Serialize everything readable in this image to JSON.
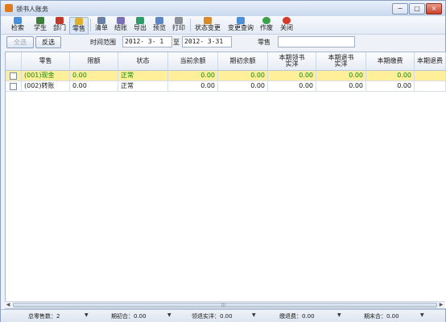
{
  "window": {
    "title": "领书人账务",
    "minimize": "−",
    "maximize": "□",
    "close": "×"
  },
  "toolbar": {
    "items": [
      {
        "label": "检索",
        "icon": "search-icon"
      },
      {
        "label": "学生",
        "icon": "student-icon"
      },
      {
        "label": "部门",
        "icon": "department-icon"
      },
      {
        "label": "零售",
        "icon": "retail-icon"
      },
      {
        "label": "清单",
        "icon": "list-icon"
      },
      {
        "label": "结账",
        "icon": "checkout-icon"
      },
      {
        "label": "导出",
        "icon": "export-icon"
      },
      {
        "label": "预览",
        "icon": "preview-icon"
      },
      {
        "label": "打印",
        "icon": "print-icon"
      },
      {
        "label": "状态变更",
        "icon": "status-change-icon"
      },
      {
        "label": "变更查询",
        "icon": "change-query-icon"
      },
      {
        "label": "作废",
        "icon": "void-icon"
      },
      {
        "label": "关闭",
        "icon": "close-icon"
      }
    ]
  },
  "filter": {
    "select_all": "全选",
    "invert": "反选",
    "time_range_label": "时间范围",
    "date_from": "2012- 3- 1",
    "to_label": "至",
    "date_to": "2012- 3-31",
    "retail_label": "零售",
    "retail_value": ""
  },
  "table": {
    "columns": [
      "零售",
      "限额",
      "状态",
      "当前余额",
      "期初余额",
      "本期领书\n实洋",
      "本期退书\n实洋",
      "本期缴费",
      "本期退费"
    ],
    "rows": [
      [
        "(001)现金",
        "0.00",
        "正常",
        "0.00",
        "0.00",
        "0.00",
        "0.00",
        "0.00",
        ""
      ],
      [
        "(002)转账",
        "0.00",
        "正常",
        "0.00",
        "0.00",
        "0.00",
        "0.00",
        "0.00",
        ""
      ]
    ]
  },
  "status": {
    "total_retail": "总零售数：2",
    "opening": "期初合：0.00",
    "received": "领退实洋：0.00",
    "payments": "缴退费：0.00",
    "closing": "期末合：0.00"
  }
}
